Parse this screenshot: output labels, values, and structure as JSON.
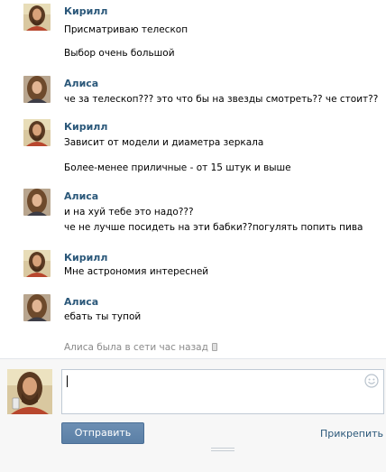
{
  "messages": [
    {
      "author": "Кирилл",
      "avatar": "kirill-avatar",
      "lines": [
        "Присматриваю телескоп",
        "Выбор очень большой"
      ]
    },
    {
      "author": "Алиса",
      "avatar": "alisa-avatar",
      "lines": [
        "че за телескоп??? это что бы на звезды смотреть?? че стоит??"
      ]
    },
    {
      "author": "Кирилл",
      "avatar": "kirill-avatar",
      "lines": [
        "Зависит от модели и диаметра зеркала",
        "Более-менее приличные - от 15 штук и выше"
      ]
    },
    {
      "author": "Алиса",
      "avatar": "alisa-avatar",
      "lines": [
        "и на хуй тебе это надо???",
        "че не лучше посидеть на эти бабки??погулять попить пива"
      ]
    },
    {
      "author": "Кирилл",
      "avatar": "kirill-avatar",
      "lines": [
        "Мне астрономия интересней"
      ]
    },
    {
      "author": "Алиса",
      "avatar": "alisa-avatar",
      "lines": [
        "ебать ты тупой"
      ]
    }
  ],
  "status": {
    "text": "Алиса была в сети час назад",
    "icon": "mobile-phone-icon"
  },
  "composer": {
    "input_value": "",
    "emoji_icon": "smile-icon",
    "send_label": "Отправить",
    "attach_label": "Прикрепить"
  },
  "colors": {
    "author_name": "#2b587a",
    "link": "#2b587a",
    "send_button": "#5f84ab",
    "status_text": "#8a8a8a"
  }
}
